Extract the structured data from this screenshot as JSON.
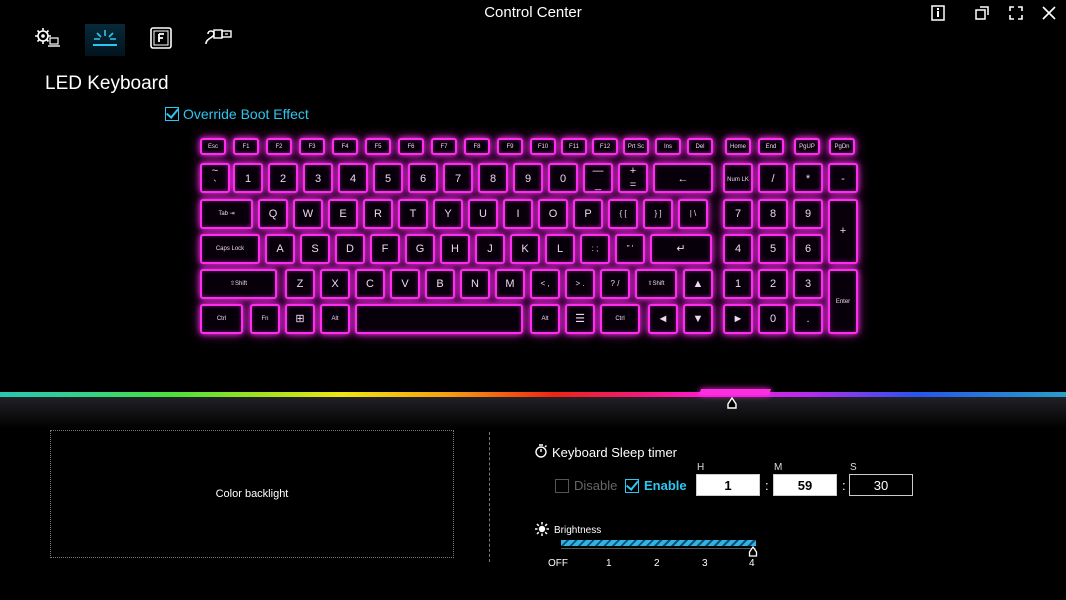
{
  "window": {
    "title": "Control Center"
  },
  "tabs": [
    {
      "icon": "gear-laptop-icon"
    },
    {
      "icon": "led-light-icon",
      "active": true
    },
    {
      "icon": "fn-key-icon"
    },
    {
      "icon": "usb-cable-icon"
    }
  ],
  "page": {
    "heading": "LED Keyboard",
    "override_label": "Override Boot Effect",
    "override_checked": true
  },
  "keyboard": {
    "row0": [
      "Esc",
      "F1",
      "F2",
      "F3",
      "F4",
      "F5",
      "F6",
      "F7",
      "F8",
      "F9",
      "F10",
      "F11",
      "F12",
      "Prt Sc",
      "Ins",
      "Del",
      "Home",
      "End",
      "PgUP",
      "PgDn"
    ],
    "row1": [
      [
        "~",
        "`"
      ],
      [
        "",
        "1"
      ],
      [
        "",
        "2"
      ],
      [
        "",
        "3"
      ],
      [
        "",
        "4"
      ],
      [
        "",
        "5"
      ],
      [
        "",
        "6"
      ],
      [
        "",
        "7"
      ],
      [
        "",
        "8"
      ],
      [
        "",
        "9"
      ],
      [
        "",
        "0"
      ],
      [
        "—",
        "_"
      ],
      [
        "+",
        "="
      ],
      [
        "",
        "←"
      ],
      [
        "",
        "Num LK"
      ],
      [
        "",
        "/"
      ],
      [
        "",
        "*"
      ],
      [
        "",
        "-"
      ]
    ],
    "row2": [
      "Tab ⇥",
      "Q",
      "W",
      "E",
      "R",
      "T",
      "Y",
      "U",
      "I",
      "O",
      "P",
      "{ [",
      "} ]",
      "| \\",
      "7",
      "8",
      "9",
      "+"
    ],
    "row3": [
      "Caps Lock",
      "A",
      "S",
      "D",
      "F",
      "G",
      "H",
      "J",
      "K",
      "L",
      ": ;",
      "\" '",
      "↵",
      "4",
      "5",
      "6"
    ],
    "row4": [
      "⇧Shift",
      "Z",
      "X",
      "C",
      "V",
      "B",
      "N",
      "M",
      "< ,",
      "> .",
      "? /",
      "⇧Shift",
      "▲",
      "1",
      "2",
      "3",
      "Enter"
    ],
    "row5": [
      "Ctrl",
      "Fn",
      "⊞",
      "Alt",
      "",
      "Alt",
      "☰",
      "Ctrl",
      "◄",
      "▼",
      "►",
      "0",
      "."
    ]
  },
  "color_backlight": {
    "label": "Color backlight",
    "selected_color": "#ff2de0"
  },
  "sleep_timer": {
    "title": "Keyboard Sleep timer",
    "disable_label": "Disable",
    "enable_label": "Enable",
    "enabled": true,
    "h_label": "H",
    "m_label": "M",
    "s_label": "S",
    "h": "1",
    "m": "59",
    "s": "30"
  },
  "brightness": {
    "title": "Brightness",
    "levels": [
      "OFF",
      "1",
      "2",
      "3",
      "4"
    ],
    "value": 4
  },
  "colors": {
    "accent": "#2dc6f2",
    "key_glow": "#ff2df0"
  }
}
